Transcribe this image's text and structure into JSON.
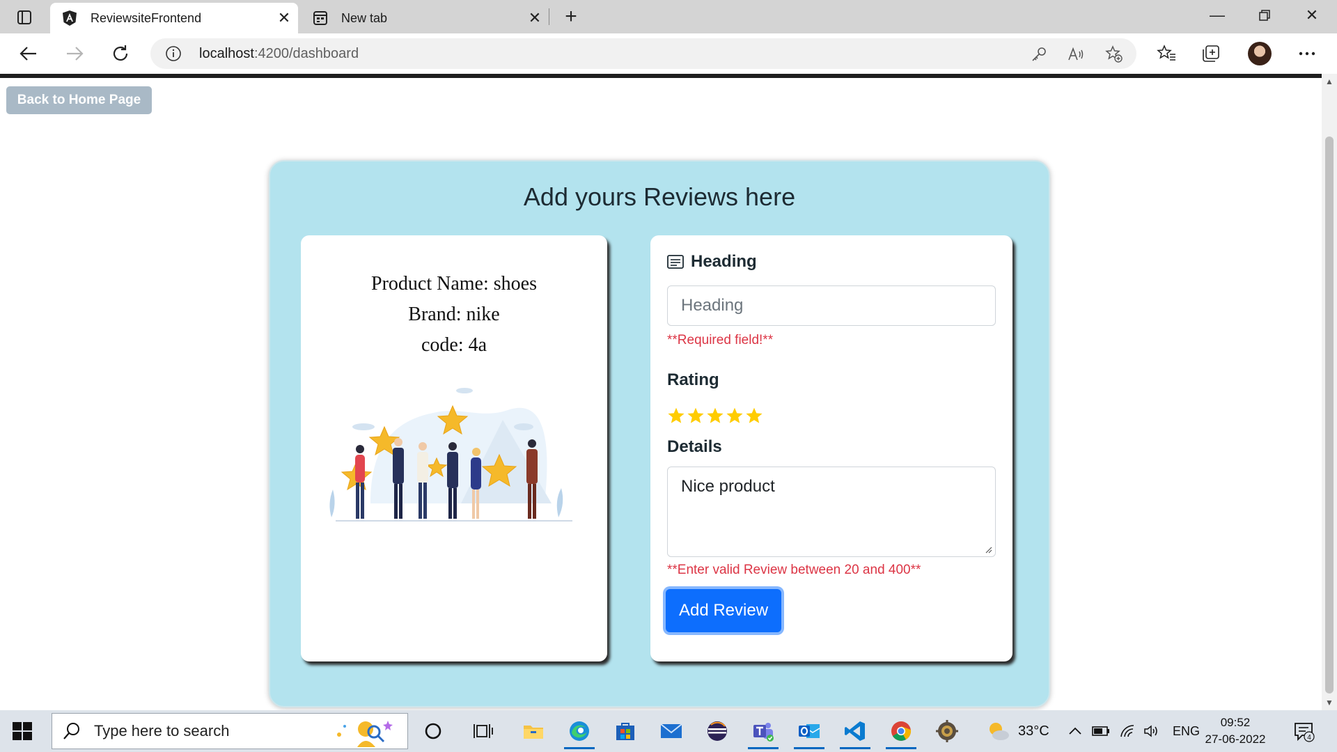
{
  "browser": {
    "tabs": [
      {
        "title": "ReviewsiteFrontend",
        "active": true
      },
      {
        "title": "New tab",
        "active": false
      }
    ],
    "url_host": "localhost",
    "url_path": ":4200/dashboard"
  },
  "page": {
    "back_button": "Back to Home Page",
    "panel_title": "Add yours Reviews here",
    "product": {
      "name_line": "Product Name: shoes",
      "brand_line": "Brand: nike",
      "code_line": "code: 4a"
    },
    "form": {
      "heading_label": "Heading",
      "heading_placeholder": "Heading",
      "heading_error": "**Required field!**",
      "rating_label": "Rating",
      "rating_value": 5,
      "rating_max": 5,
      "details_label": "Details",
      "details_value": "Nice product",
      "details_error": "**Enter valid Review between 20 and 400**",
      "submit_label": "Add Review"
    }
  },
  "taskbar": {
    "search_placeholder": "Type here to search",
    "weather_temp": "33°C",
    "language": "ENG",
    "time": "09:52",
    "date": "27-06-2022",
    "notification_count": "4"
  },
  "colors": {
    "panel_bg": "#b3e3ee",
    "primary": "#0d6efd",
    "error": "#dc3545",
    "back_button_bg": "#a9b9c6",
    "star": "#ffcc00"
  }
}
